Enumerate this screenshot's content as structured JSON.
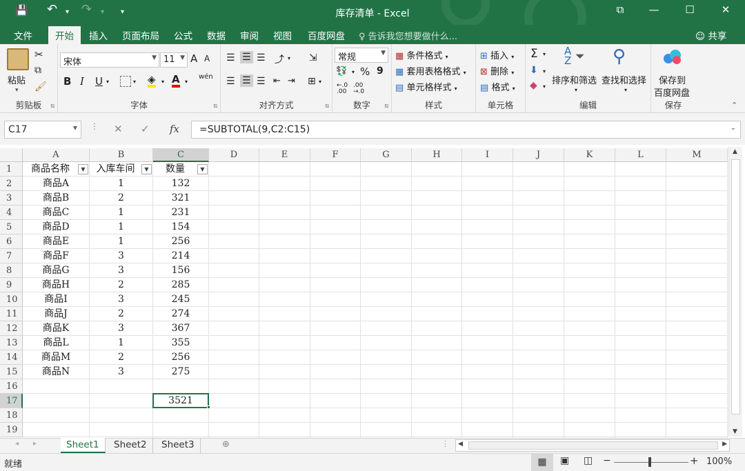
{
  "window": {
    "title": "库存清单 - Excel",
    "minimize": "—",
    "maximize": "☐",
    "close": "✕",
    "restore_ribbon": "⧉"
  },
  "qat": {
    "save": "💾",
    "undo": "↶",
    "undo_arrow": "▾",
    "redo": "↷",
    "redo_arrow": "▾",
    "customize": "▾"
  },
  "tabs": [
    "文件",
    "开始",
    "插入",
    "页面布局",
    "公式",
    "数据",
    "审阅",
    "视图",
    "百度网盘"
  ],
  "active_tab": "开始",
  "tell_me": "♀ 告诉我您想要做什么...",
  "share": "共享",
  "ribbon": {
    "clipboard": {
      "label": "剪贴板",
      "paste": "粘贴"
    },
    "font": {
      "label": "字体",
      "name": "宋体",
      "size": "11",
      "bold": "B",
      "italic": "I",
      "underline": "U",
      "grow": "A",
      "shrink": "A",
      "wen": "wén"
    },
    "alignment": {
      "label": "对齐方式"
    },
    "number": {
      "label": "数字",
      "format": "常规",
      "percent": "%",
      "comma": "9"
    },
    "styles": {
      "label": "样式",
      "conditional": "条件格式",
      "table": "套用表格格式",
      "cell_styles": "单元格样式"
    },
    "cells": {
      "label": "单元格",
      "insert": "插入",
      "delete": "删除",
      "format": "格式"
    },
    "editing": {
      "label": "编辑",
      "sigma": "Σ",
      "sort": "排序和筛选",
      "find": "查找和选择"
    },
    "save": {
      "label": "保存",
      "save_to": "保存到",
      "baidu": "百度网盘"
    }
  },
  "formula_bar": {
    "name_box": "C17",
    "formula": "=SUBTOTAL(9,C2:C15)",
    "fx": "fx"
  },
  "columns": [
    "A",
    "B",
    "C",
    "D",
    "E",
    "F",
    "G",
    "H",
    "I",
    "J",
    "K",
    "L",
    "M"
  ],
  "rows": [
    "1",
    "2",
    "3",
    "4",
    "5",
    "6",
    "7",
    "8",
    "9",
    "10",
    "11",
    "12",
    "13",
    "14",
    "15",
    "16",
    "17",
    "18",
    "19"
  ],
  "headers": [
    "商品名称",
    "入库车间",
    "数量"
  ],
  "data_rows": [
    [
      "商品A",
      "1",
      "132"
    ],
    [
      "商品B",
      "2",
      "321"
    ],
    [
      "商品C",
      "1",
      "231"
    ],
    [
      "商品D",
      "1",
      "154"
    ],
    [
      "商品E",
      "1",
      "256"
    ],
    [
      "商品F",
      "3",
      "214"
    ],
    [
      "商品G",
      "3",
      "156"
    ],
    [
      "商品H",
      "2",
      "285"
    ],
    [
      "商品I",
      "3",
      "245"
    ],
    [
      "商品J",
      "2",
      "274"
    ],
    [
      "商品K",
      "3",
      "367"
    ],
    [
      "商品L",
      "1",
      "355"
    ],
    [
      "商品M",
      "2",
      "256"
    ],
    [
      "商品N",
      "3",
      "275"
    ]
  ],
  "total": "3521",
  "sheets": [
    "Sheet1",
    "Sheet2",
    "Sheet3"
  ],
  "active_sheet": "Sheet1",
  "status": {
    "ready": "就绪",
    "zoom": "100%"
  },
  "colors": {
    "accent": "#217346"
  }
}
